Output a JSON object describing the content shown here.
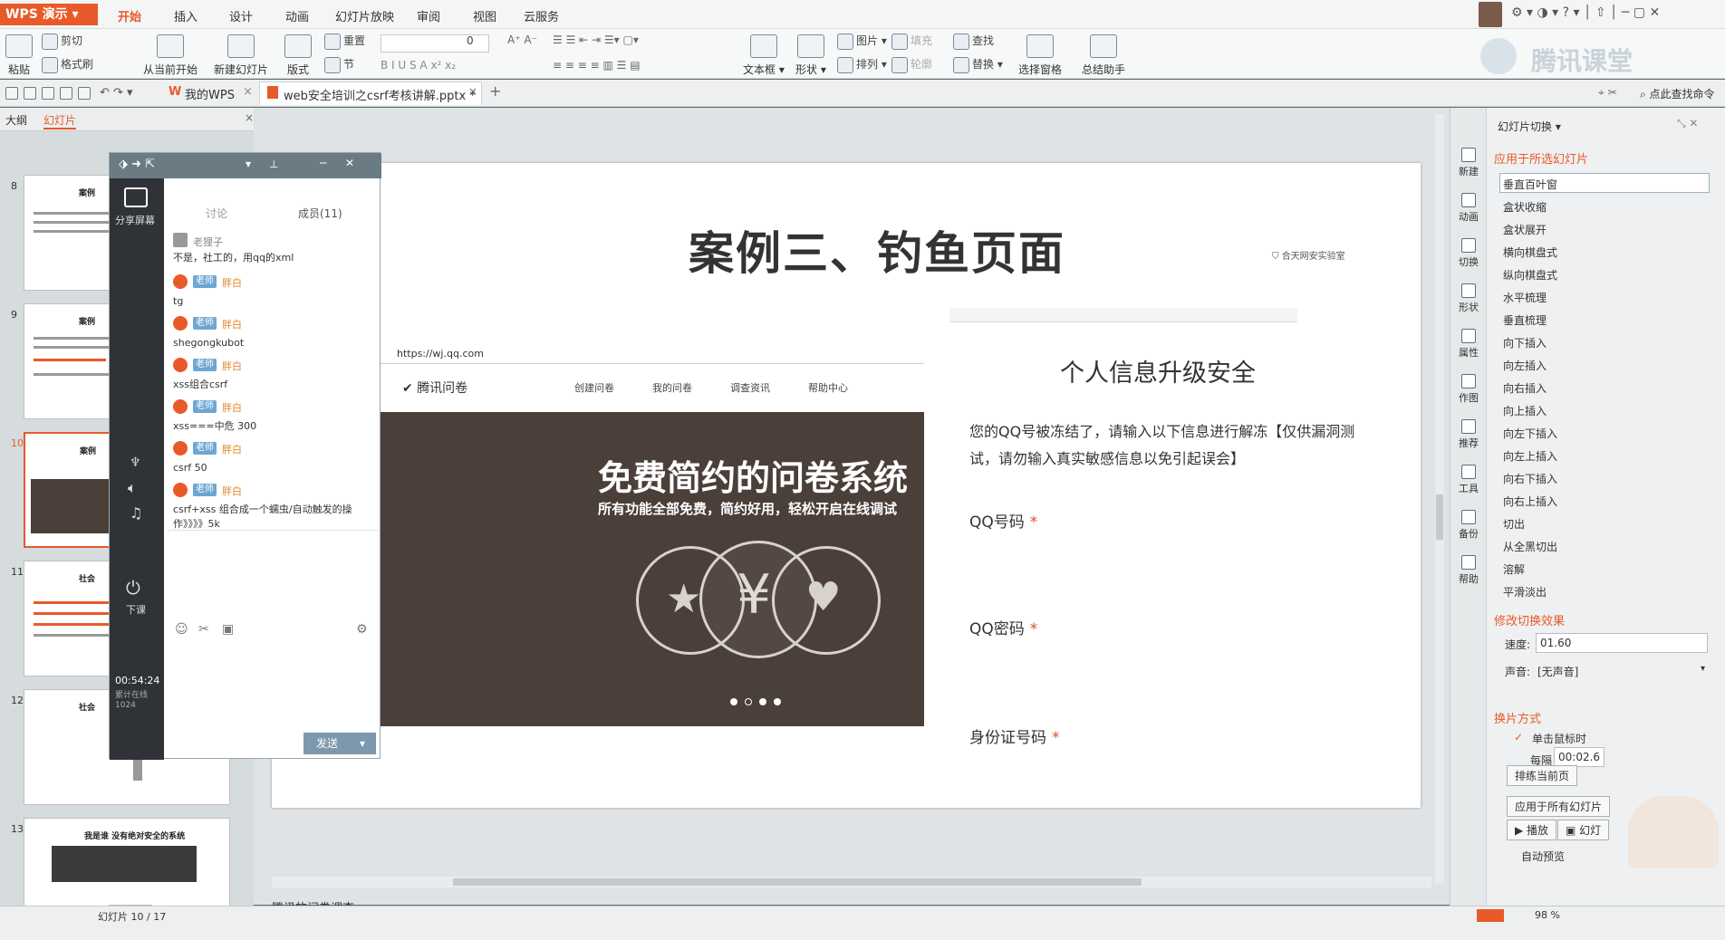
{
  "app": {
    "logo": "WPS 演示"
  },
  "menus": [
    "开始",
    "插入",
    "设计",
    "动画",
    "幻灯片放映",
    "审阅",
    "视图",
    "云服务"
  ],
  "ribbon": {
    "paste": "粘贴",
    "cut": "剪切",
    "format_painter": "格式刷",
    "new_slide": "从当前开始",
    "new_slide2": "新建幻灯片",
    "layout": "版式",
    "reset": "重置",
    "section": "节",
    "font_size": "0",
    "textbox": "文本框",
    "shape": "形状",
    "picture": "图片",
    "arrange": "排列",
    "fill": "填充",
    "outline": "轮廓",
    "find": "查找",
    "replace": "替换",
    "select_pane": "选择窗格",
    "summary": "总结助手"
  },
  "watermark": "腾讯课堂",
  "tabbar": {
    "my_wps": "我的WPS",
    "doc_title": "web安全培训之csrf考核讲解.pptx *",
    "find_cmd": "点此查找命令"
  },
  "left_panel": {
    "tab_outline": "大纲",
    "tab_slides": "幻灯片",
    "slide_numbers": [
      "8",
      "9",
      "10",
      "11",
      "12",
      "13"
    ],
    "thumb_titles": [
      "案例",
      "案例",
      "案例",
      "社会",
      "社会",
      "我是谁 没有绝对安全的系统"
    ]
  },
  "chat": {
    "share_screen": "分享屏幕",
    "tab_discuss": "讨论",
    "tab_members": "成员(11)",
    "end_class": "下课",
    "timer": "00:54:24",
    "timer_sub": "累计在线 1024",
    "messages": [
      {
        "user": "老狸子",
        "text": "不是，社工的，用qq的xml"
      },
      {
        "user": "胖白",
        "tag": "老师",
        "text": "tg"
      },
      {
        "user": "胖白",
        "tag": "老师",
        "text": "shegongkubot"
      },
      {
        "user": "胖白",
        "tag": "老师",
        "text": "xss组合csrf"
      },
      {
        "user": "胖白",
        "tag": "老师",
        "text": "xss===中危 300"
      },
      {
        "user": "胖白",
        "tag": "老师",
        "text": "csrf 50"
      },
      {
        "user": "胖白",
        "tag": "老师",
        "text": "csrf+xss 组合成一个蠕虫/自动触发的操作》》》》5k"
      }
    ],
    "send": "发送"
  },
  "slide": {
    "title": "案例三、钓鱼页面",
    "logo_text": "合天网安实验室",
    "url": "https://wj.qq.com",
    "brand": "腾讯问卷",
    "nav": [
      "创建问卷",
      "我的问卷",
      "调查资讯",
      "帮助中心"
    ],
    "banner_title": "免费简约的问卷系统",
    "banner_sub": "所有功能全部免费，简约好用，轻松开启在线调试",
    "form_title": "个人信息升级安全",
    "form_desc": "您的QQ号被冻结了，请输入以下信息进行解冻【仅供漏洞测试，请勿输入真实敏感信息以免引起误会】",
    "fields": [
      "QQ号码",
      "QQ密码",
      "身份证号码"
    ],
    "required_mark": "*"
  },
  "notes": "腾讯的问卷调查",
  "right_panel": {
    "header": "幻灯片切换",
    "apply_selected": "应用于所选幻灯片",
    "side_icons": [
      "新建",
      "动画",
      "切换",
      "形状",
      "属性",
      "作图",
      "推荐",
      "工具",
      "备份",
      "帮助"
    ],
    "transitions": [
      "垂直百叶窗",
      "盒状收缩",
      "盒状展开",
      "横向棋盘式",
      "纵向棋盘式",
      "水平梳理",
      "垂直梳理",
      "向下插入",
      "向左插入",
      "向右插入",
      "向上插入",
      "向左下插入",
      "向左上插入",
      "向右下插入",
      "向右上插入",
      "切出",
      "从全黑切出",
      "溶解",
      "平滑淡出"
    ],
    "modify_effect": "修改切换效果",
    "speed_label": "速度:",
    "speed_value": "01.60",
    "sound_label": "声音:",
    "sound_value": "[无声音]",
    "advance_header": "换片方式",
    "on_click": "单击鼠标时",
    "every_label": "每隔",
    "every_value": "00:02.6",
    "apply_current": "排练当前页",
    "apply_all": "应用于所有幻灯片",
    "play": "播放",
    "slideshow": "幻灯",
    "auto_preview": "自动预览"
  },
  "status": {
    "slide_count": "幻灯片 10 / 17",
    "zoom": "98 %"
  },
  "colors": {
    "accent": "#e85a29",
    "banner": "#4b3f3a",
    "chat_side": "#2f3338"
  }
}
